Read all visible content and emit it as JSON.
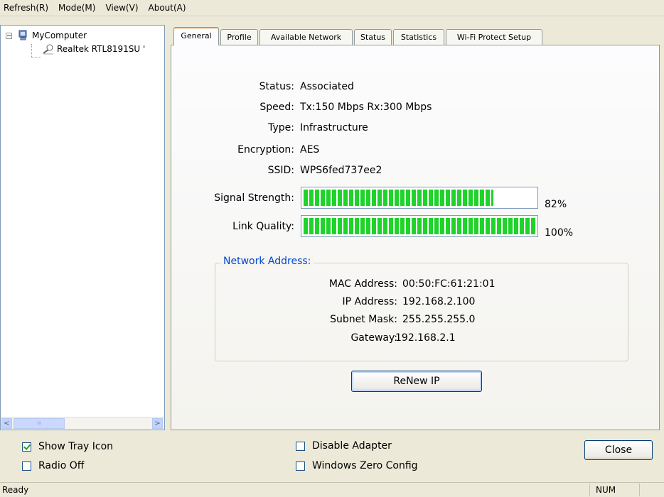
{
  "menu": {
    "items": [
      "Refresh(R)",
      "Mode(M)",
      "View(V)",
      "About(A)"
    ]
  },
  "tree": {
    "root_label": "MyComputer",
    "child_label": "Realtek RTL8191SU '",
    "expander_symbol": "−",
    "scroll_left": "<",
    "scroll_right": ">",
    "scroll_thumb_grip": "III"
  },
  "tabs": [
    "General",
    "Profile",
    "Available Network",
    "Status",
    "Statistics",
    "Wi-Fi Protect Setup"
  ],
  "general": {
    "status_label": "Status:",
    "status_value": "Associated",
    "speed_label": "Speed:",
    "speed_value": "Tx:150 Mbps Rx:300 Mbps",
    "type_label": "Type:",
    "type_value": "Infrastructure",
    "encryption_label": "Encryption:",
    "encryption_value": "AES",
    "ssid_label": "SSID:",
    "ssid_value": "WPS6fed737ee2",
    "signal_label": "Signal Strength:",
    "signal_percent": 82,
    "signal_percent_text": "82%",
    "link_label": "Link Quality:",
    "link_percent": 100,
    "link_percent_text": "100%"
  },
  "network_address": {
    "title": "Network Address:",
    "mac_label": "MAC Address:",
    "mac_value": "00:50:FC:61:21:01",
    "ip_label": "IP Address:",
    "ip_value": "192.168.2.100",
    "subnet_label": "Subnet Mask:",
    "subnet_value": "255.255.255.0",
    "gateway_label": "Gateway:",
    "gateway_value": "192.168.2.1"
  },
  "renew_button": "ReNew IP",
  "options": {
    "show_tray_icon": {
      "label": "Show Tray Icon",
      "checked": true
    },
    "radio_off": {
      "label": "Radio Off",
      "checked": false
    },
    "disable_adapter": {
      "label": "Disable Adapter",
      "checked": false
    },
    "windows_zero_config": {
      "label": "Windows Zero Config",
      "checked": false
    }
  },
  "close_button": "Close",
  "statusbar": {
    "text": "Ready",
    "num": "NUM"
  },
  "colors": {
    "bar_green": "#1fd32a",
    "group_title": "#0046d5",
    "tab_highlight": "#e68b2c"
  }
}
